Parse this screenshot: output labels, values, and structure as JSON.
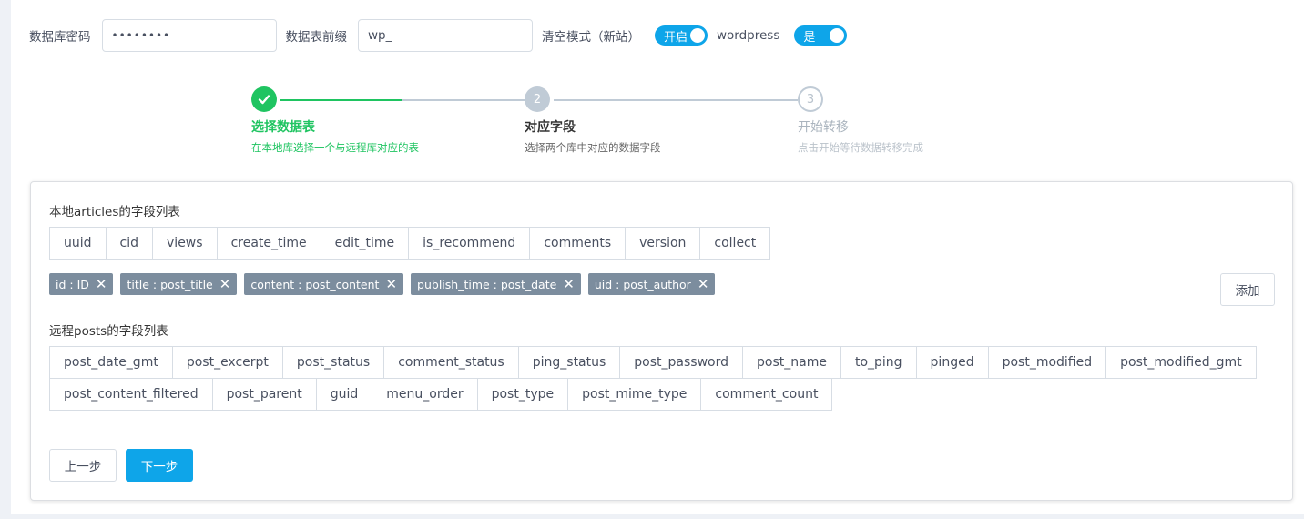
{
  "form": {
    "db_password_label": "数据库密码",
    "db_password_value": "••••••••",
    "table_prefix_label": "数据表前缀",
    "table_prefix_value": "wp_",
    "clear_mode_label": "清空模式（新站）",
    "clear_mode_toggle": "开启",
    "wordpress_label": "wordpress",
    "wordpress_toggle": "是"
  },
  "steps": [
    {
      "number": "1",
      "title": "选择数据表",
      "desc": "在本地库选择一个与远程库对应的表",
      "status": "done"
    },
    {
      "number": "2",
      "title": "对应字段",
      "desc": "选择两个库中对应的数据字段",
      "status": "process"
    },
    {
      "number": "3",
      "title": "开始转移",
      "desc": "点击开始等待数据转移完成",
      "status": "wait"
    }
  ],
  "local": {
    "title": "本地articles的字段列表",
    "fields": [
      "uuid",
      "cid",
      "views",
      "create_time",
      "edit_time",
      "is_recommend",
      "comments",
      "version",
      "collect"
    ]
  },
  "mappings": [
    {
      "label": "id : ID"
    },
    {
      "label": "title : post_title"
    },
    {
      "label": "content : post_content"
    },
    {
      "label": "publish_time : post_date"
    },
    {
      "label": "uid : post_author"
    }
  ],
  "add_button": "添加",
  "remote": {
    "title": "远程posts的字段列表",
    "fields_row1": [
      "post_date_gmt",
      "post_excerpt",
      "post_status",
      "comment_status",
      "ping_status",
      "post_password",
      "post_name",
      "to_ping",
      "pinged",
      "post_modified",
      "post_modified_gmt"
    ],
    "fields_row2": [
      "post_content_filtered",
      "post_parent",
      "guid",
      "menu_order",
      "post_type",
      "post_mime_type",
      "comment_count"
    ]
  },
  "nav": {
    "prev": "上一步",
    "next": "下一步"
  },
  "colors": {
    "accent": "#0ea5e9",
    "success": "#1fc461",
    "tag": "#7c8d9e"
  }
}
